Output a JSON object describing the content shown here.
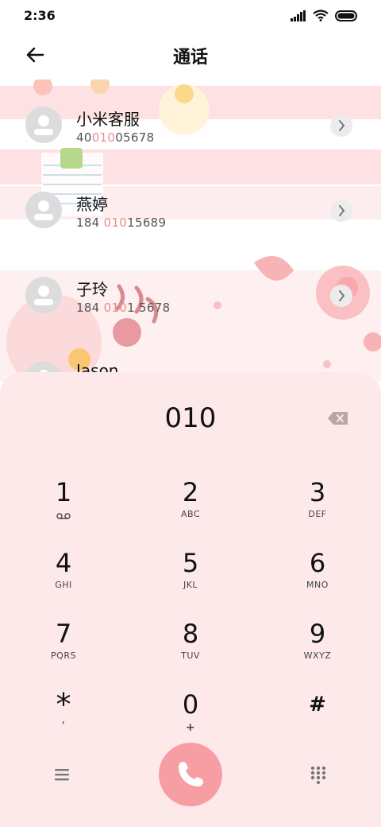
{
  "status_bar": {
    "time": "2:36",
    "icons": [
      "signal-icon",
      "wifi-icon",
      "battery-icon"
    ]
  },
  "header": {
    "title": "通话",
    "back_icon": "back-arrow-icon"
  },
  "contacts": [
    {
      "name": "小米客服",
      "number_before": "40",
      "number_match": "010",
      "number_after": "05678"
    },
    {
      "name": "燕婷",
      "number_before": "184 ",
      "number_match": "010",
      "number_after": "15689"
    },
    {
      "name": "子玲",
      "number_before": "184 ",
      "number_match": "010",
      "number_after": "1 5678"
    },
    {
      "name": "Jason",
      "number_before": "",
      "number_match": "",
      "number_after": ""
    }
  ],
  "dialer": {
    "number": "010",
    "keys": [
      {
        "digit": "1",
        "letters": "voicemail"
      },
      {
        "digit": "2",
        "letters": "ABC"
      },
      {
        "digit": "3",
        "letters": "DEF"
      },
      {
        "digit": "4",
        "letters": "GHI"
      },
      {
        "digit": "5",
        "letters": "JKL"
      },
      {
        "digit": "6",
        "letters": "MNO"
      },
      {
        "digit": "7",
        "letters": "PQRS"
      },
      {
        "digit": "8",
        "letters": "TUV"
      },
      {
        "digit": "9",
        "letters": "WXYZ"
      },
      {
        "digit": "*",
        "letters": ","
      },
      {
        "digit": "0",
        "letters": "+"
      },
      {
        "digit": "#",
        "letters": ""
      }
    ]
  },
  "colors": {
    "accent": "#f79ea4",
    "highlight": "#f08a8a",
    "panel": "#fde9ea",
    "stripe": "#fde1e3"
  }
}
